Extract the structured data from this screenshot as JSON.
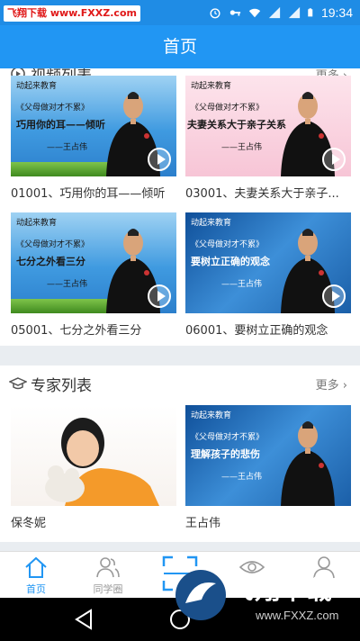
{
  "status_bar": {
    "watermark": "飞翔下载 www.FXXZ.com",
    "time": "19:34",
    "icons": [
      "alarm-icon",
      "key-icon",
      "wifi-icon",
      "signal-icon",
      "signal-icon",
      "battery-icon"
    ]
  },
  "header": {
    "title": "首页"
  },
  "video_section": {
    "title": "视频列表",
    "more": "更多",
    "items": [
      {
        "caption": "01001、巧用你的耳——倾听",
        "thumb_lines": [
          "动起来教育",
          "《父母做对才不累》",
          "巧用你的耳——倾听",
          "——王占伟"
        ]
      },
      {
        "caption": "03001、夫妻关系大于亲子...",
        "thumb_lines": [
          "动起来教育",
          "《父母做对才不累》",
          "夫妻关系大于亲子关系",
          "——王占伟"
        ]
      },
      {
        "caption": "05001、七分之外看三分",
        "thumb_lines": [
          "动起来教育",
          "《父母做对才不累》",
          "七分之外看三分",
          "——王占伟"
        ]
      },
      {
        "caption": "06001、要树立正确的观念",
        "thumb_lines": [
          "动起来教育",
          "《父母做对才不累》",
          "要树立正确的观念",
          "——王占伟"
        ]
      }
    ]
  },
  "expert_section": {
    "title": "专家列表",
    "more": "更多",
    "items": [
      {
        "name": "保冬妮"
      },
      {
        "name": "王占伟",
        "thumb_lines": [
          "动起来教育",
          "《父母做对才不累》",
          "理解孩子的悲伤",
          "——王占伟"
        ]
      }
    ]
  },
  "bottom_nav": [
    {
      "label": "首页",
      "icon": "home-icon",
      "active": true
    },
    {
      "label": "同学圈",
      "icon": "people-icon",
      "active": false
    },
    {
      "label": "",
      "icon": "scan-icon",
      "active": false
    },
    {
      "label": "",
      "icon": "eye-icon",
      "active": false
    },
    {
      "label": "",
      "icon": "person-icon",
      "active": false
    }
  ],
  "watermark_bottom": {
    "text": "飞翔下载",
    "url": "www.FXXZ.com"
  },
  "colors": {
    "primary": "#2196f3",
    "statusbar": "#1f8ce5",
    "active_nav": "#2196f3"
  }
}
